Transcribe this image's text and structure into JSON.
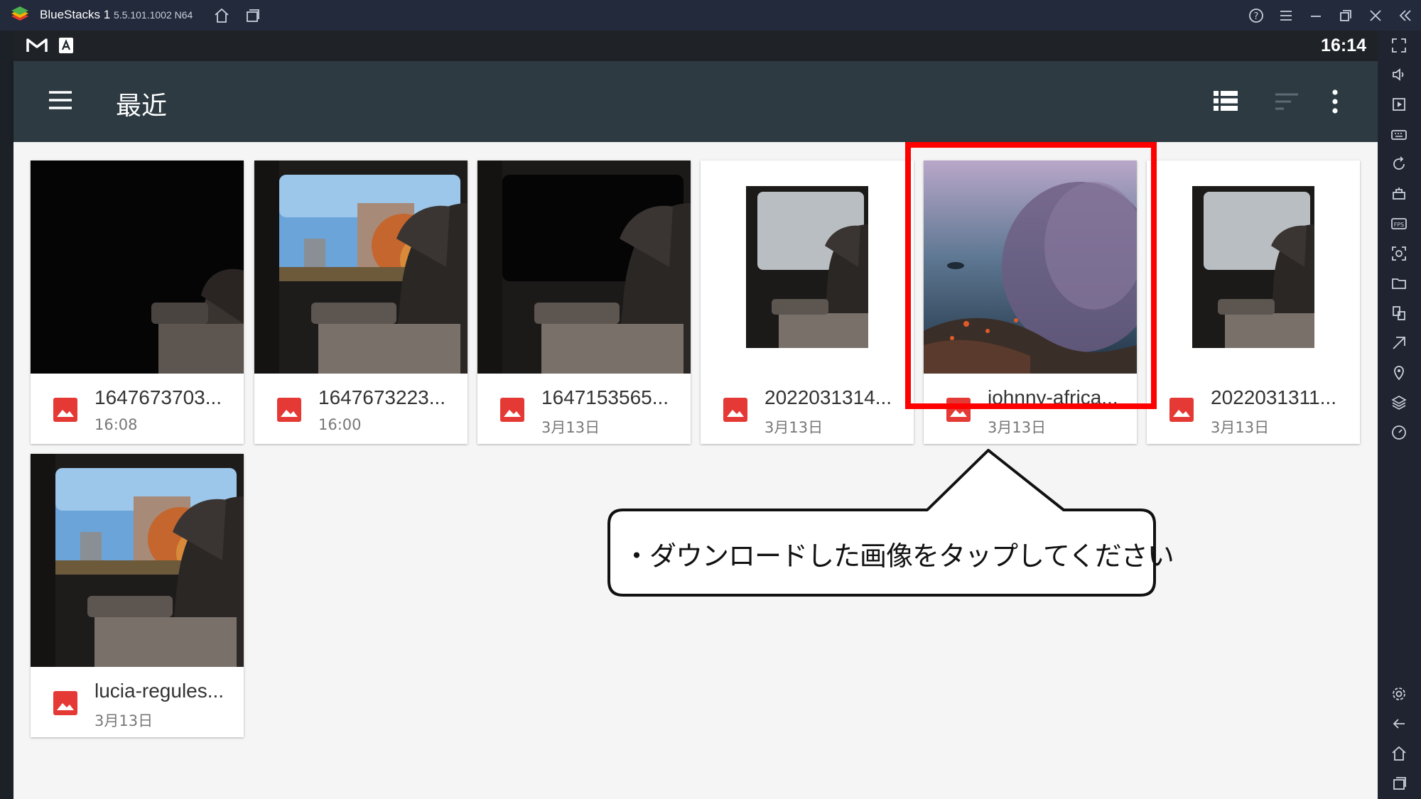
{
  "window": {
    "app_name": "BlueStacks 1",
    "app_version": "5.5.101.1002  N64"
  },
  "status_bar": {
    "time": "16:14",
    "notification_icons": [
      "gmail-icon",
      "a-badge-icon"
    ]
  },
  "toolbar": {
    "title": "最近",
    "icons": [
      "menu-icon",
      "list-view-icon",
      "sort-icon",
      "more-vert-icon"
    ]
  },
  "files": [
    {
      "name": "1647673703...",
      "date": "16:08",
      "thumbnail": "train-seat-dark"
    },
    {
      "name": "1647673223...",
      "date": "16:00",
      "thumbnail": "train-seat-city"
    },
    {
      "name": "1647153565...",
      "date": "3月13日",
      "thumbnail": "train-seat-dark"
    },
    {
      "name": "2022031314...",
      "date": "3月13日",
      "thumbnail": "train-seat-grey"
    },
    {
      "name": "johnny-africa...",
      "date": "3月13日",
      "thumbnail": "underwater-fish"
    },
    {
      "name": "2022031311...",
      "date": "3月13日",
      "thumbnail": "train-seat-grey"
    },
    {
      "name": "lucia-regules...",
      "date": "3月13日",
      "thumbnail": "train-seat-city"
    }
  ],
  "callout": {
    "text": "・ダウンロードした画像をタップしてください"
  },
  "colors": {
    "toolbar": "#2d3a42",
    "highlight": "#ff0000",
    "image_icon": "#e53935"
  }
}
